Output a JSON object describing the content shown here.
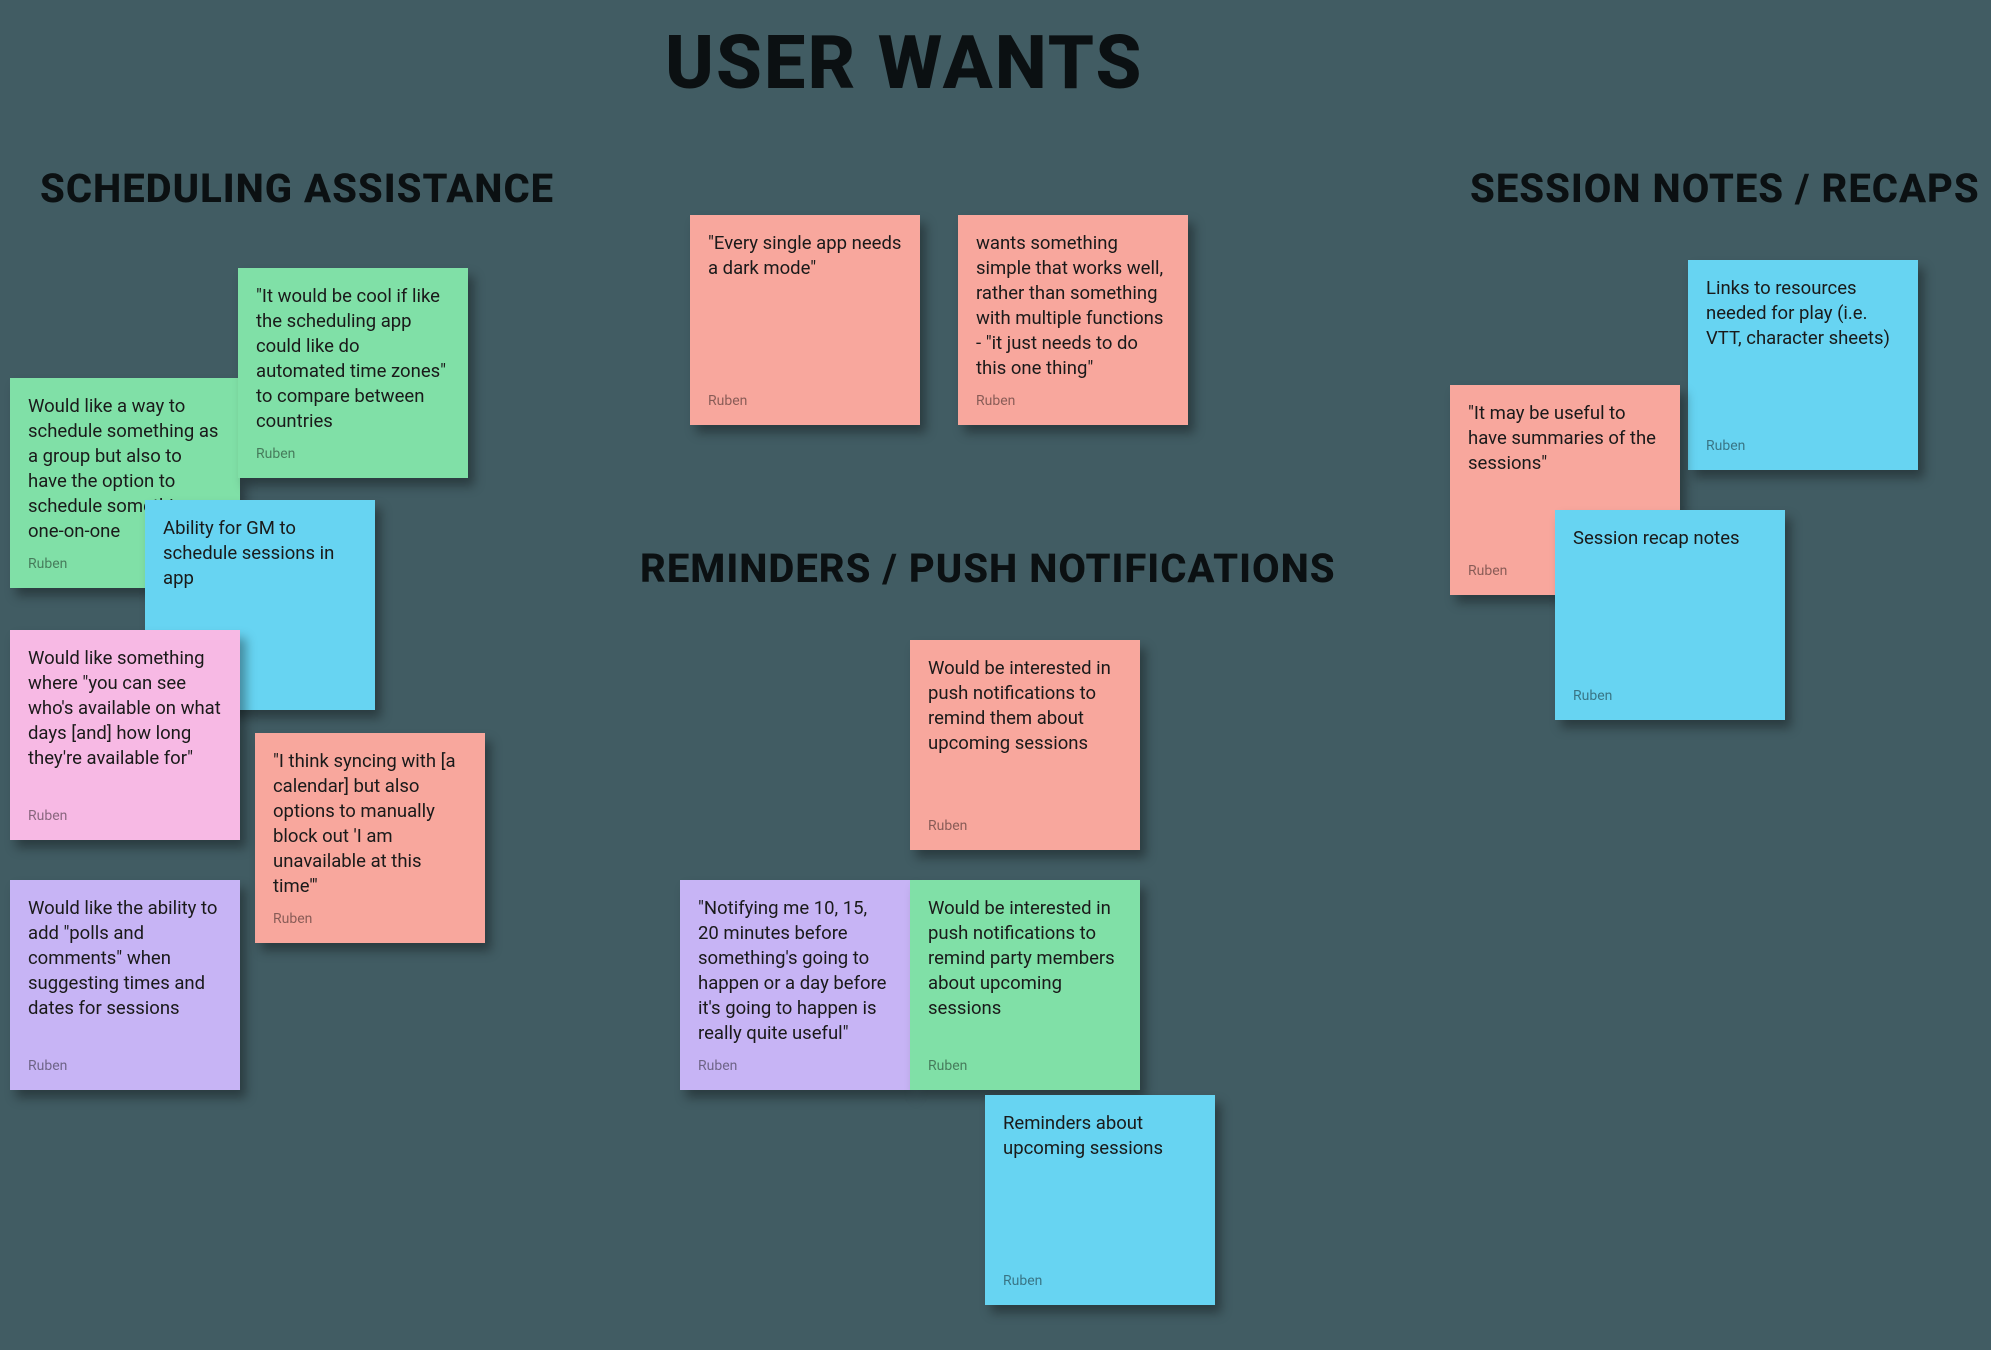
{
  "titles": {
    "main": "USER WANTS",
    "scheduling": "SCHEDULING ASSISTANCE",
    "reminders": "REMINDERS / PUSH NOTIFICATIONS",
    "recaps": "SESSION NOTES / RECAPS"
  },
  "notes": {
    "sched_timezones": {
      "text": "\"It would be cool if like the scheduling app could like do automated time zones\" to compare between countries",
      "author": "Ruben"
    },
    "sched_group_one": {
      "text": "Would like a way to schedule something as a group but also to have the option to schedule something one-on-one",
      "author": "Ruben"
    },
    "sched_gm": {
      "text": "Ability for GM to schedule sessions in app",
      "author": ""
    },
    "sched_availability": {
      "text": "Would like something where \"you can see who's available on what days [and] how long they're available for\"",
      "author": "Ruben"
    },
    "sched_sync": {
      "text": "\"I think syncing with [a calendar] but also options to manually block out 'I am unavailable at this time'\"",
      "author": "Ruben"
    },
    "sched_polls": {
      "text": "Would like the ability to add \"polls and comments\" when suggesting times and dates for sessions",
      "author": "Ruben"
    },
    "gen_darkmode": {
      "text": "\"Every single app needs a dark mode\"",
      "author": "Ruben"
    },
    "gen_simple": {
      "text": "wants something simple that works well, rather than something with multiple functions - \"it just needs to do this one thing\"",
      "author": "Ruben"
    },
    "rem_push_self": {
      "text": "Would be interested in push notifications to remind them about upcoming sessions",
      "author": "Ruben"
    },
    "rem_notify_before": {
      "text": "\"Notifying me 10, 15, 20 minutes before something's going to happen or a day before it's going to happen is really quite useful\"",
      "author": "Ruben"
    },
    "rem_push_party": {
      "text": "Would be interested in push notifications to remind party members about upcoming sessions",
      "author": "Ruben"
    },
    "rem_upcoming": {
      "text": "Reminders about upcoming sessions",
      "author": "Ruben"
    },
    "recap_links": {
      "text": "Links to resources needed for play (i.e. VTT, character sheets)",
      "author": "Ruben"
    },
    "recap_summaries": {
      "text": "\"It may be useful to have summaries of the sessions\"",
      "author": "Ruben"
    },
    "recap_notes": {
      "text": "Session recap notes",
      "author": "Ruben"
    }
  }
}
